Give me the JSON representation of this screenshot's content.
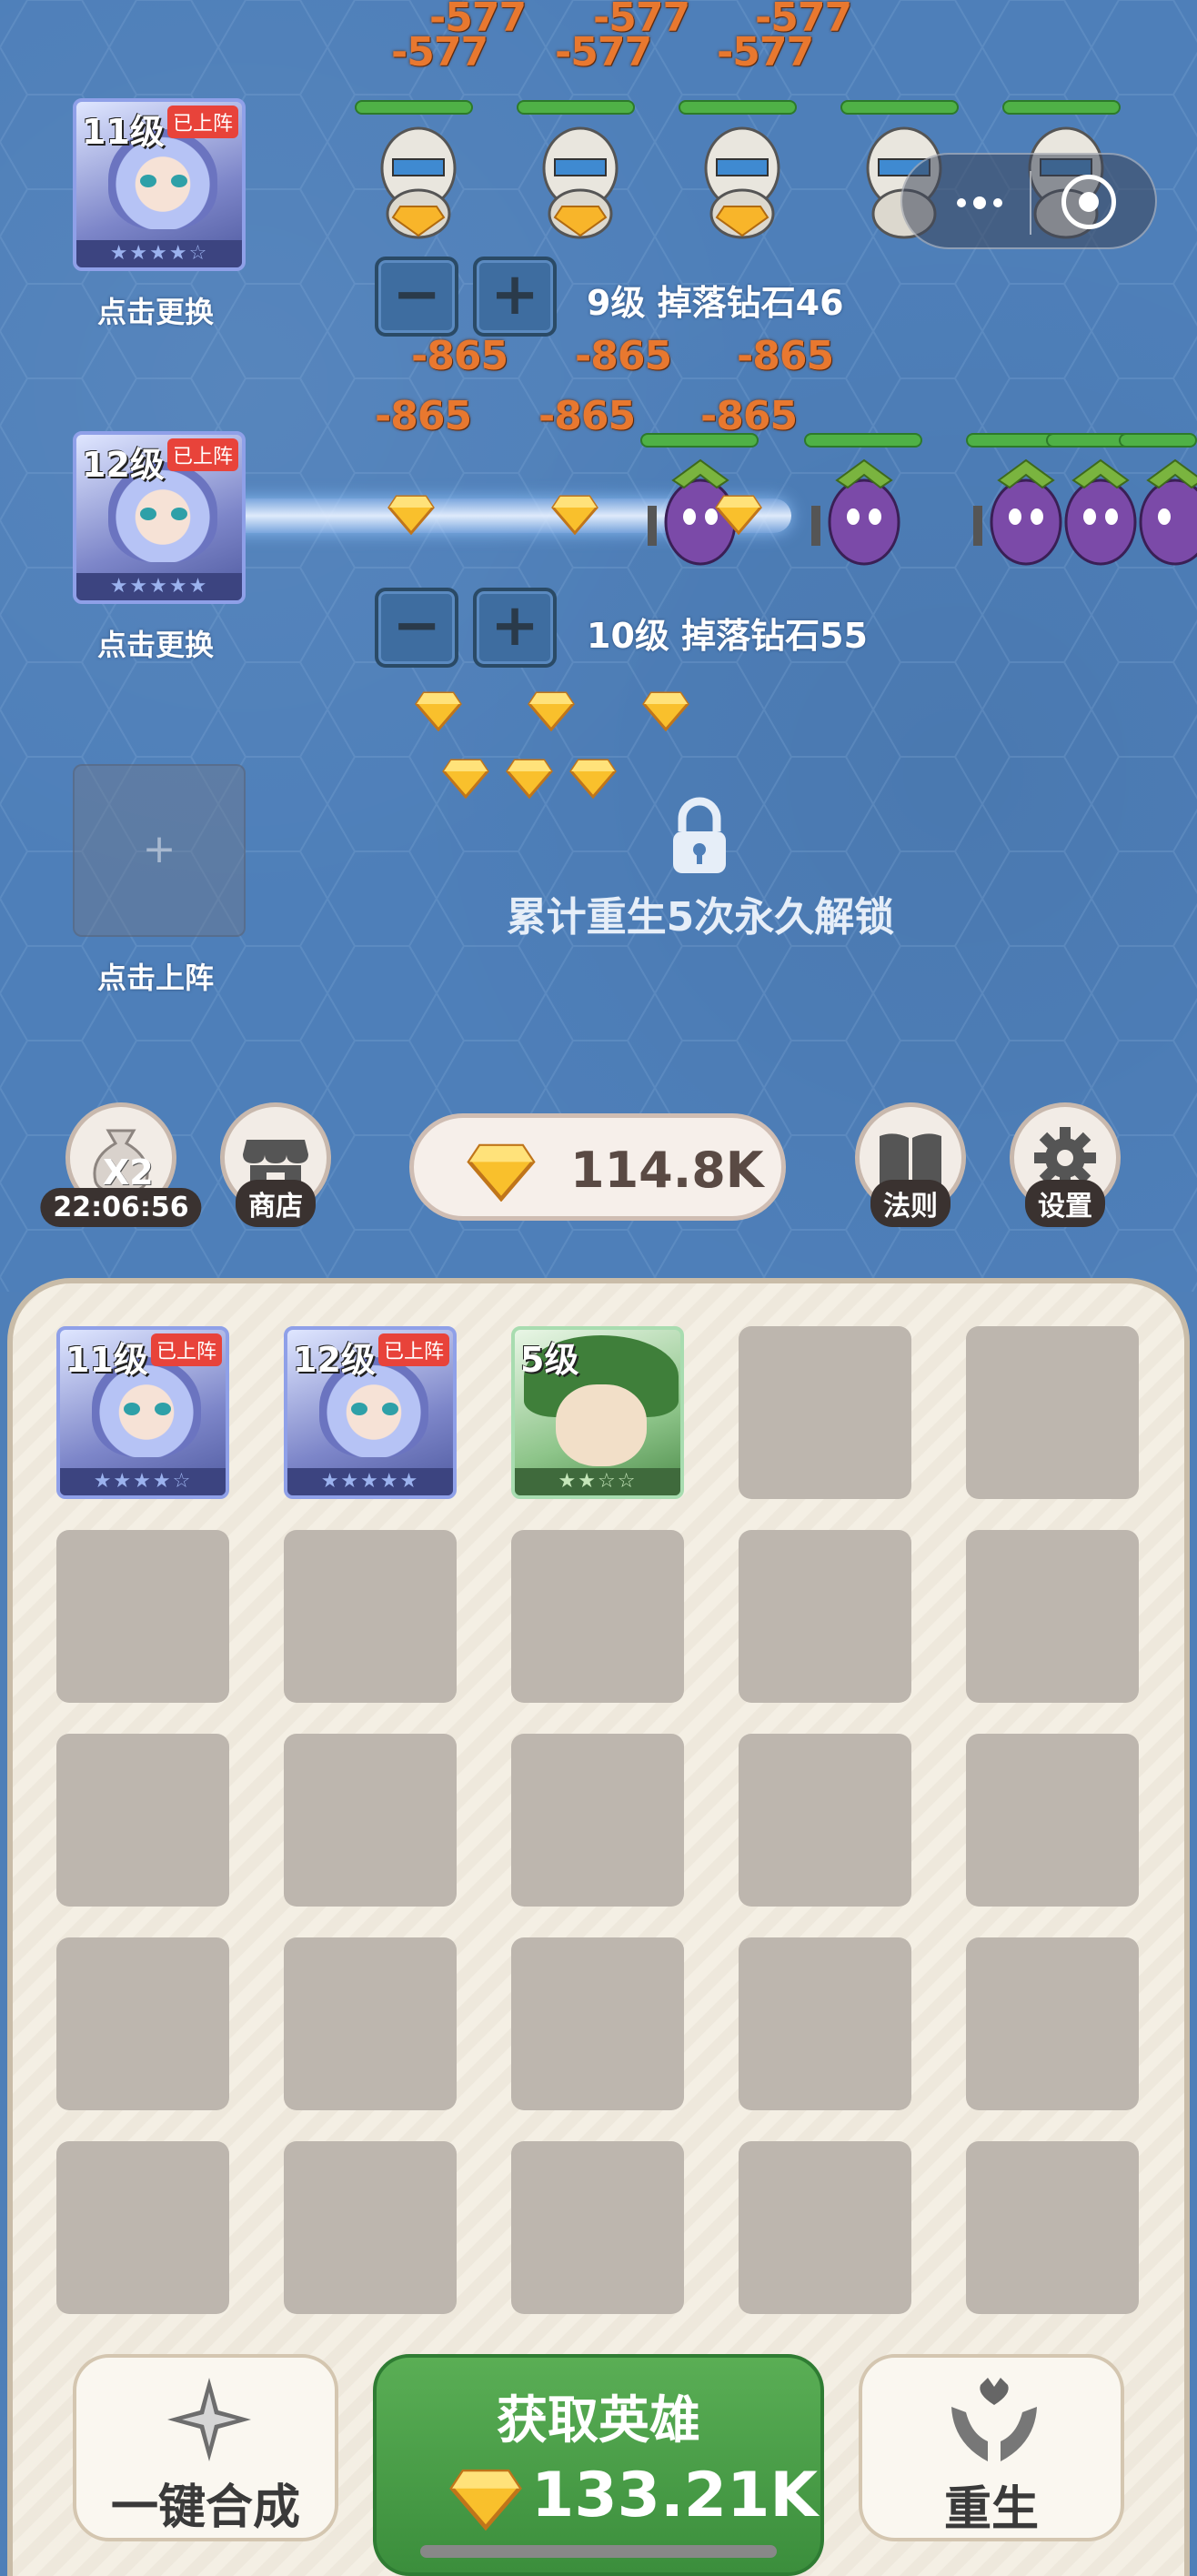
{
  "battle": {
    "damage_row1_top": [
      "-577",
      "-577",
      "-577"
    ],
    "damage_row1_bottom": [
      "-577",
      "-577",
      "-577"
    ],
    "damage_row2_top": [
      "-865",
      "-865",
      "-865"
    ],
    "damage_row2_bottom": [
      "-865",
      "-865",
      "-865"
    ],
    "lane1": {
      "card_level": "11级",
      "card_tag": "已上阵",
      "card_stars": "★★★★☆",
      "change_label": "点击更换",
      "minus": "−",
      "plus": "+",
      "info": "9级 掉落钻石46"
    },
    "lane2": {
      "card_level": "12级",
      "card_tag": "已上阵",
      "card_stars": "★★★★★",
      "change_label": "点击更换",
      "minus": "−",
      "plus": "+",
      "info": "10级 掉落钻石55"
    },
    "lane3": {
      "add_symbol": "+",
      "deploy_label": "点击上阵",
      "lock_text": "累计重生5次永久解锁"
    }
  },
  "toolbar": {
    "boost_badge": "X2",
    "boost_timer": "22:06:56",
    "shop_label": "商店",
    "currency_value": "114.8K",
    "rules_label": "法则",
    "settings_label": "设置"
  },
  "inventory": {
    "heroes": [
      {
        "level": "11级",
        "tag": "已上阵",
        "stars": "★★★★☆"
      },
      {
        "level": "12级",
        "tag": "已上阵",
        "stars": "★★★★★"
      },
      {
        "level": "5级",
        "tag": "",
        "stars": "★★☆☆"
      }
    ]
  },
  "bottom": {
    "merge_label": "一键合成",
    "get_hero_label": "获取英雄",
    "get_hero_cost": "133.21K",
    "rebirth_label": "重生"
  },
  "colors": {
    "accent_green": "#3b8e3c",
    "damage_orange": "#e8782f",
    "tag_red": "#e8433a",
    "battle_blue": "#4e7fb9"
  }
}
